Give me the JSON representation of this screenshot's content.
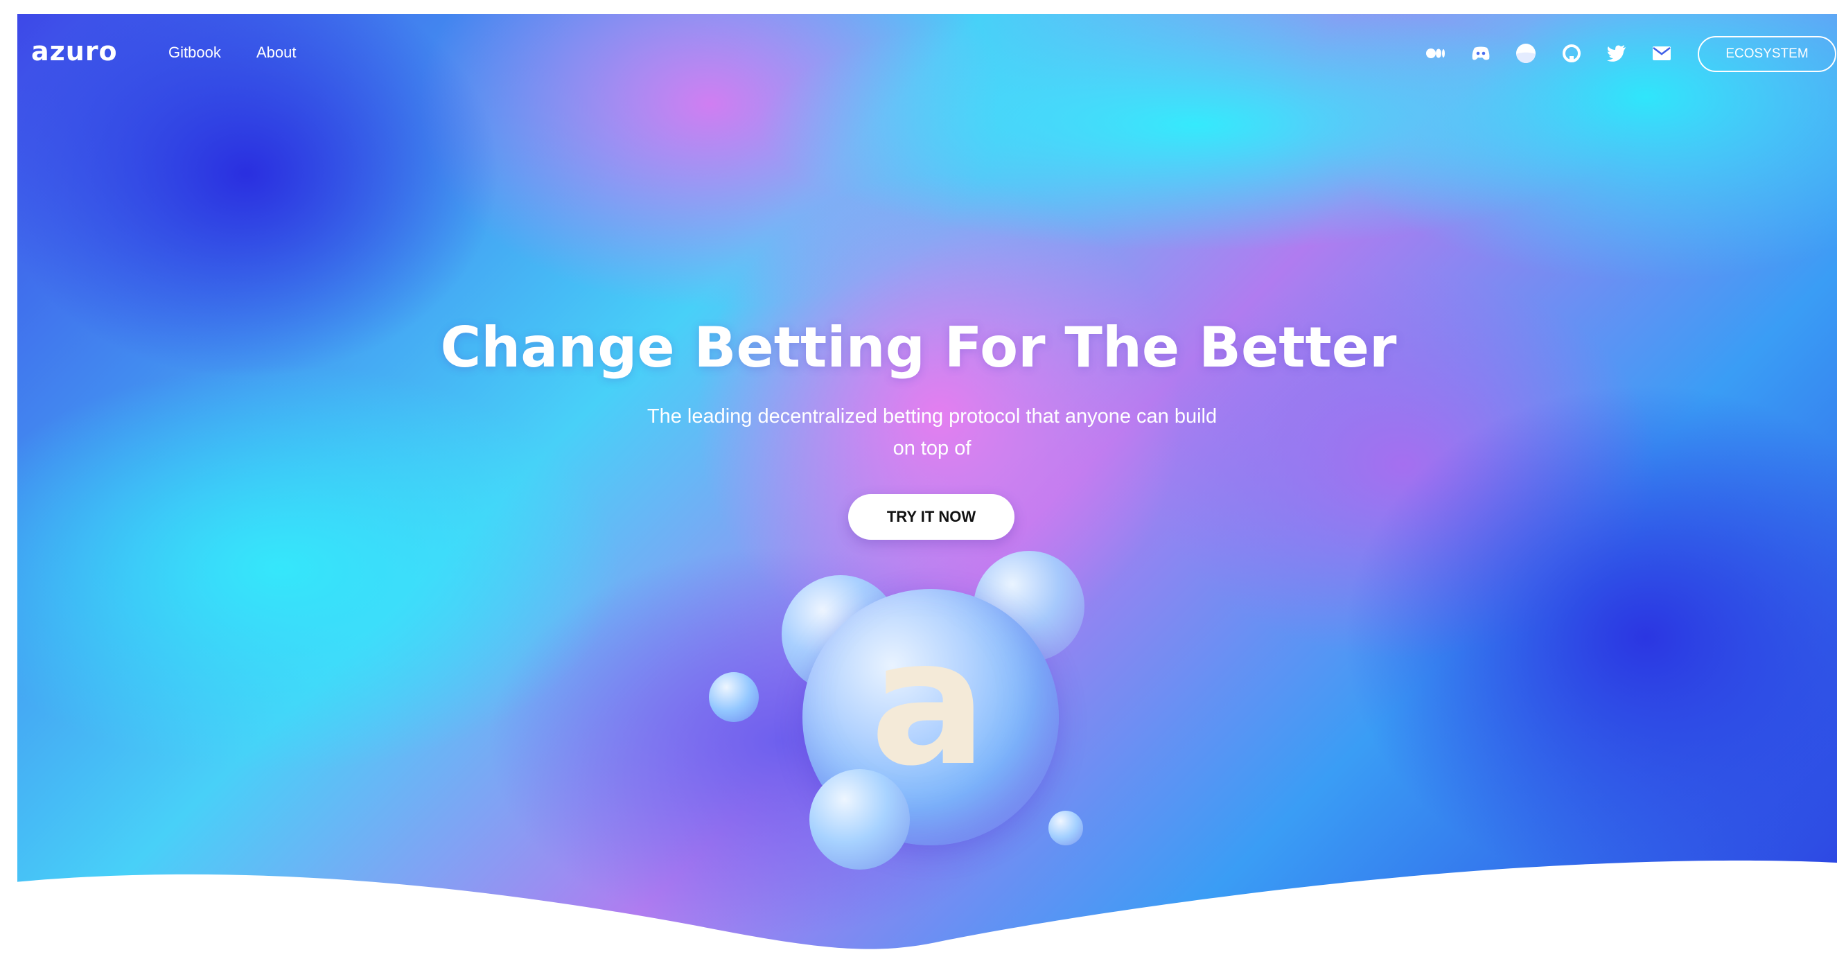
{
  "header": {
    "logo": "azuro",
    "nav": [
      {
        "label": "Gitbook"
      },
      {
        "label": "About"
      }
    ],
    "social_icons": [
      "medium-icon",
      "discord-icon",
      "mirror-icon",
      "github-icon",
      "twitter-icon",
      "mail-icon"
    ],
    "ecosystem_label": "ECOSYSTEM"
  },
  "hero": {
    "title": "Change Betting For The Better",
    "subtitle": "The leading decentralized betting protocol that anyone can build on top of",
    "cta_label": "TRY IT NOW",
    "mascot_letter": "a"
  },
  "colors": {
    "cyan": "#35eafc",
    "blue": "#2a2fe0",
    "pink": "#e47ef0",
    "white": "#ffffff"
  }
}
